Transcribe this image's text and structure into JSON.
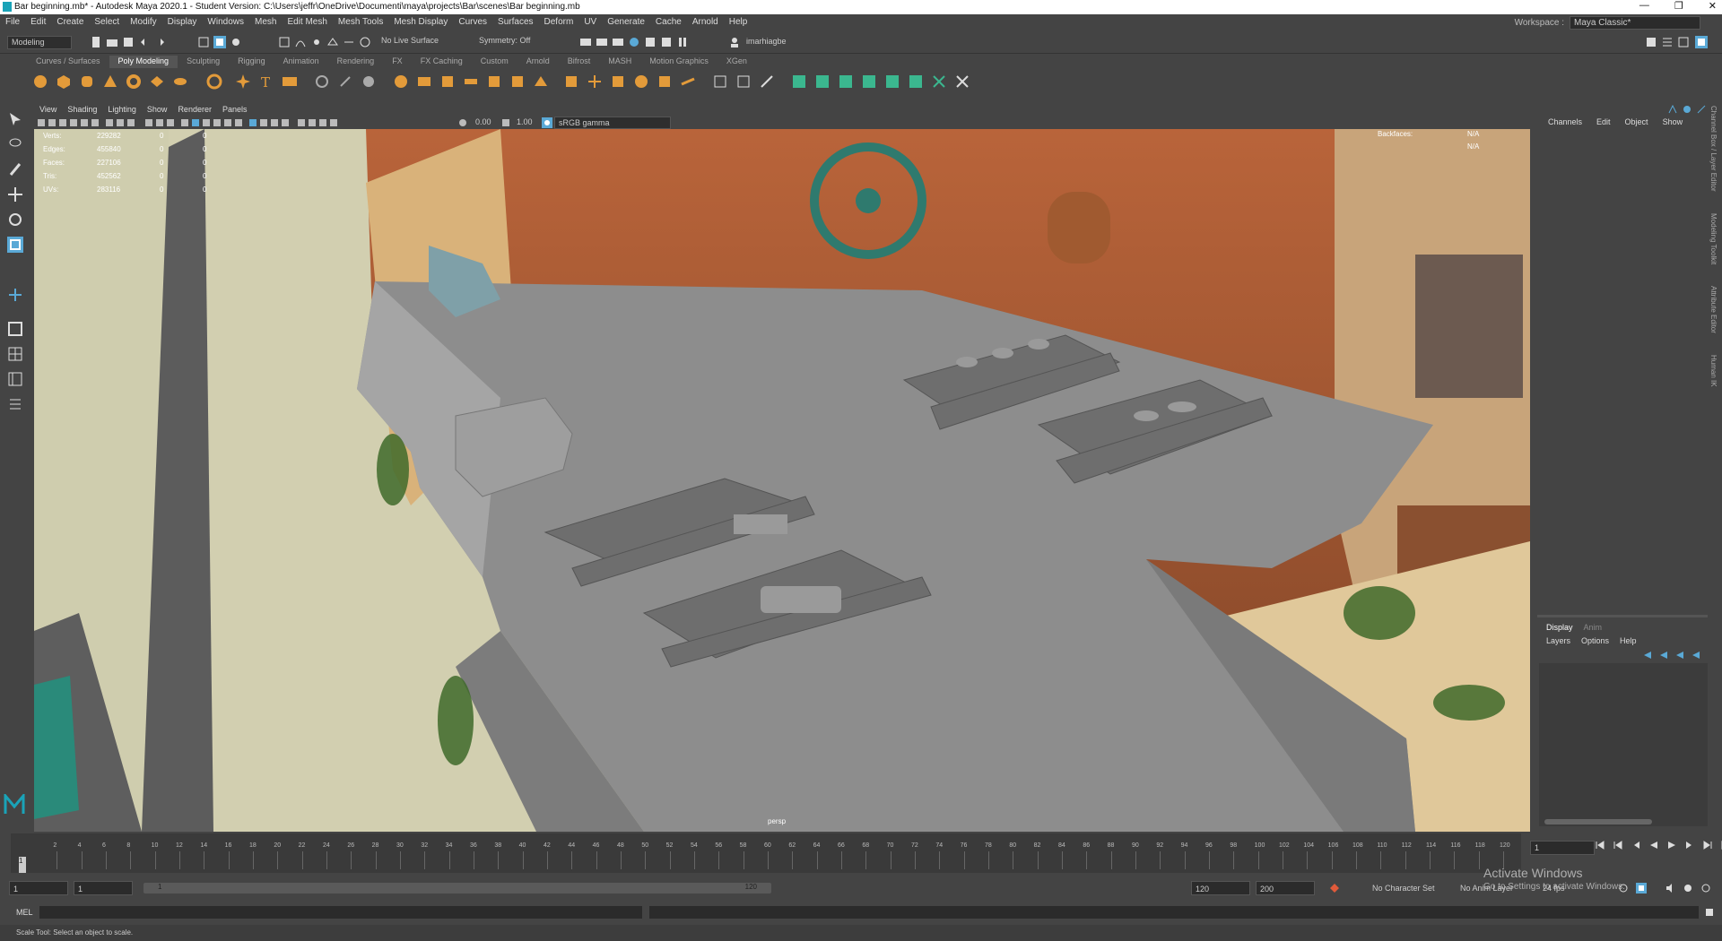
{
  "window": {
    "title": "Bar beginning.mb* - Autodesk Maya 2020.1 - Student Version: C:\\Users\\jeffr\\OneDrive\\Documenti\\maya\\projects\\Bar\\scenes\\Bar beginning.mb",
    "controls": [
      "—",
      "❐",
      "✕"
    ]
  },
  "menubar": [
    "File",
    "Edit",
    "Create",
    "Select",
    "Modify",
    "Display",
    "Windows",
    "Mesh",
    "Edit Mesh",
    "Mesh Tools",
    "Mesh Display",
    "Curves",
    "Surfaces",
    "Deform",
    "UV",
    "Generate",
    "Cache",
    "Arnold",
    "Help"
  ],
  "workspace": {
    "label": "Workspace :",
    "value": "Maya Classic*"
  },
  "statusline": {
    "mode": "Modeling",
    "live_surface": "No Live Surface",
    "symmetry": "Symmetry: Off",
    "user": "imarhiagbe"
  },
  "shelf": {
    "tabs": [
      "Curves / Surfaces",
      "Poly Modeling",
      "Sculpting",
      "Rigging",
      "Animation",
      "Rendering",
      "FX",
      "FX Caching",
      "Custom",
      "Arnold",
      "Bifrost",
      "MASH",
      "Motion Graphics",
      "XGen"
    ],
    "active": "Poly Modeling"
  },
  "panel": {
    "menus": [
      "View",
      "Shading",
      "Lighting",
      "Show",
      "Renderer",
      "Panels"
    ],
    "exposure": "0.00",
    "gamma": "1.00",
    "colorspace": "sRGB gamma",
    "camera": "persp"
  },
  "hud": {
    "rows": [
      {
        "label": "Verts:",
        "value": "229282",
        "sel": "0",
        "comp": "0"
      },
      {
        "label": "Edges:",
        "value": "455840",
        "sel": "0",
        "comp": "0"
      },
      {
        "label": "Faces:",
        "value": "227106",
        "sel": "0",
        "comp": "0"
      },
      {
        "label": "Tris:",
        "value": "452562",
        "sel": "0",
        "comp": "0"
      },
      {
        "label": "UVs:",
        "value": "283116",
        "sel": "0",
        "comp": "0"
      }
    ],
    "right_rows": [
      {
        "label": "Backfaces:",
        "value": "N/A"
      },
      {
        "label": "",
        "value": "N/A"
      }
    ]
  },
  "channelbox": {
    "menus": [
      "Channels",
      "Edit",
      "Object",
      "Show"
    ],
    "side_tabs": [
      "Channel Box / Layer Editor",
      "Modeling Toolkit",
      "Attribute Editor",
      "Human IK"
    ]
  },
  "layer_editor": {
    "tabs": [
      "Display",
      "Anim"
    ],
    "menus": [
      "Layers",
      "Options",
      "Help"
    ]
  },
  "timeline": {
    "ticks": [
      "2",
      "4",
      "6",
      "8",
      "10",
      "12",
      "14",
      "16",
      "18",
      "20",
      "22",
      "24",
      "26",
      "28",
      "30",
      "32",
      "34",
      "36",
      "38",
      "40",
      "42",
      "44",
      "46",
      "48",
      "50",
      "52",
      "54",
      "56",
      "58",
      "60",
      "62",
      "64",
      "66",
      "68",
      "70",
      "72",
      "74",
      "76",
      "78",
      "80",
      "82",
      "84",
      "86",
      "88",
      "90",
      "92",
      "94",
      "96",
      "98",
      "100",
      "102",
      "104",
      "106",
      "108",
      "110",
      "112",
      "114",
      "116",
      "118",
      "120"
    ],
    "current_frame": "1",
    "current_field": "1"
  },
  "range": {
    "start": "1",
    "anim_start": "1",
    "slider_start": "1",
    "slider_end": "120",
    "end": "120",
    "anim_end": "200",
    "character_set": "No Character Set",
    "anim_layer": "No Anim Layer",
    "fps": "24 fps"
  },
  "cmdline": {
    "label": "MEL"
  },
  "helpline": {
    "text": "Scale Tool: Select an object to scale."
  },
  "watermark": {
    "line1": "Activate Windows",
    "line2": "Go to Settings to activate Windows."
  },
  "colors": {
    "accent": "#5aa9d6",
    "icon": "#e39b3a",
    "green": "#3bb78f"
  }
}
